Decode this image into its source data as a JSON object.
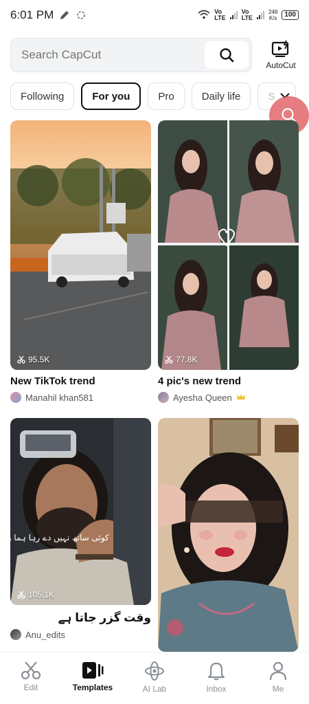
{
  "status_bar": {
    "time": "6:01 PM",
    "net1": "Vo",
    "net1b": "LTE",
    "net2": "Vo",
    "net2b": "LTE",
    "speed_value": "248",
    "speed_unit": "K/s",
    "battery": "100"
  },
  "search": {
    "placeholder": "Search CapCut",
    "autocut_label": "AutoCut"
  },
  "tabs": [
    {
      "label": "Following",
      "active": false
    },
    {
      "label": "For you",
      "active": true
    },
    {
      "label": "Pro",
      "active": false
    },
    {
      "label": "Daily life",
      "active": false
    },
    {
      "label": "S",
      "active": false
    }
  ],
  "cards": [
    {
      "title": "New TikTok trend",
      "author": "Manahil khan581",
      "uses": "95.5K"
    },
    {
      "title": "4 pic's new trend",
      "author": "Ayesha Queen",
      "uses": "77.8K"
    },
    {
      "title": "وقت گزر جاتا ہے",
      "author": "Anu_edits",
      "uses": "105.1K",
      "overlay_text": "کوئی ساتھ نہیں دے رہا ہما را"
    },
    {
      "title": "",
      "author": "",
      "uses": ""
    }
  ],
  "nav": [
    {
      "label": "Edit",
      "icon": "scissors-icon",
      "active": false
    },
    {
      "label": "Templates",
      "icon": "templates-icon",
      "active": true
    },
    {
      "label": "AI Lab",
      "icon": "ai-lab-icon",
      "active": false
    },
    {
      "label": "Inbox",
      "icon": "bell-icon",
      "active": false
    },
    {
      "label": "Me",
      "icon": "person-icon",
      "active": false
    }
  ],
  "colors": {
    "accent": "#111111",
    "float_button": "#e26064",
    "search_bg": "#f1f3f5"
  }
}
